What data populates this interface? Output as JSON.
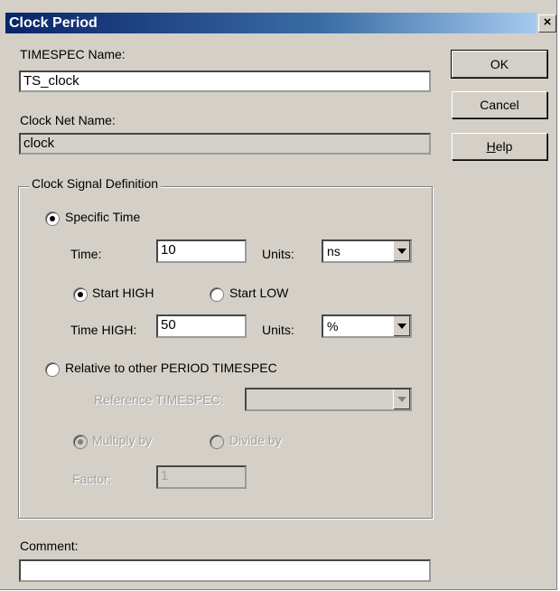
{
  "window": {
    "title": "Clock Period",
    "close_glyph": "×"
  },
  "timespec": {
    "label": "TIMESPEC Name:",
    "value": "TS_clock"
  },
  "net": {
    "label": "Clock Net Name:",
    "value": "clock"
  },
  "buttons": {
    "ok": "OK",
    "cancel": "Cancel",
    "help_first": "H",
    "help_rest": "elp"
  },
  "group": {
    "title": "Clock Signal Definition",
    "specific_time": {
      "label": "Specific Time",
      "selected": true
    },
    "time": {
      "label": "Time:",
      "value": "10",
      "units_label": "Units:",
      "units_value": "ns"
    },
    "start_high": {
      "label": "Start HIGH",
      "selected": true
    },
    "start_low": {
      "label": "Start LOW",
      "selected": false
    },
    "time_high": {
      "label": "Time HIGH:",
      "value": "50",
      "units_label": "Units:",
      "units_value": "%"
    },
    "relative": {
      "label": "Relative to other PERIOD TIMESPEC",
      "selected": false
    },
    "reference": {
      "label": "Reference TIMESPEC:",
      "value": ""
    },
    "multiply": {
      "label": "Multiply by",
      "selected": true
    },
    "divide": {
      "label": "Divide by",
      "selected": false
    },
    "factor": {
      "label": "Factor:",
      "value": "1"
    }
  },
  "comment": {
    "label": "Comment:",
    "value": ""
  }
}
